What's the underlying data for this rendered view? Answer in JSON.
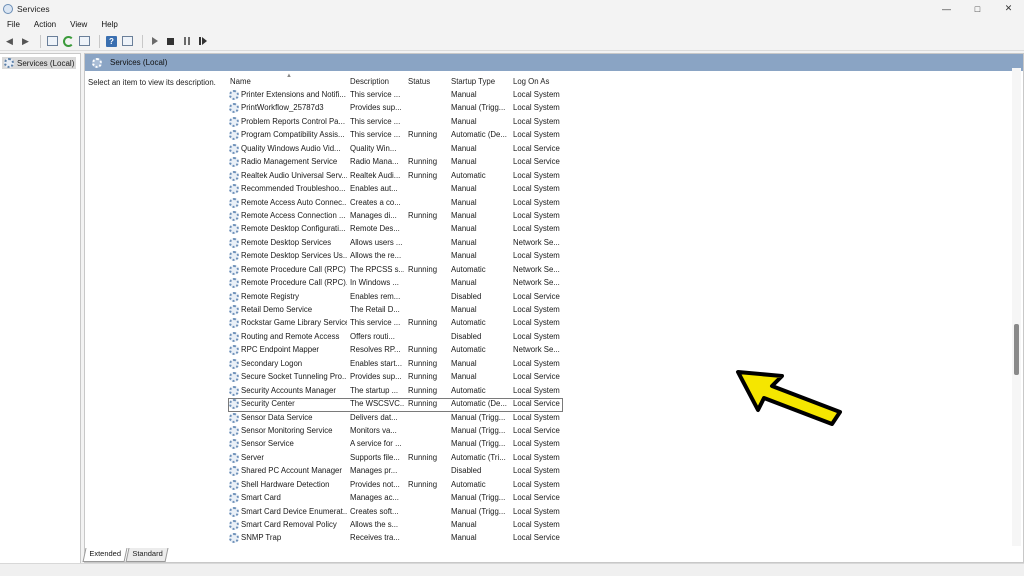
{
  "window": {
    "title": "Services",
    "controls": {
      "minimize": "—",
      "maximize": "□",
      "close": "✕"
    }
  },
  "menu": [
    "File",
    "Action",
    "View",
    "Help"
  ],
  "toolbar": {
    "icons": [
      "back-icon",
      "forward-icon",
      "show-hide-tree-icon",
      "refresh-icon",
      "export-icon",
      "help-icon",
      "properties-icon",
      "start-icon",
      "stop-icon",
      "pause-icon",
      "restart-icon"
    ]
  },
  "tree": {
    "root_label": "Services (Local)"
  },
  "pane": {
    "header_title": "Services (Local)",
    "description_prompt": "Select an item to view its description."
  },
  "table": {
    "columns": [
      "Name",
      "Description",
      "Status",
      "Startup Type",
      "Log On As"
    ],
    "rows": [
      {
        "name": "Printer Extensions and Notifi...",
        "description": "This service ...",
        "status": "",
        "startup": "Manual",
        "logon": "Local System"
      },
      {
        "name": "PrintWorkflow_25787d3",
        "description": "Provides sup...",
        "status": "",
        "startup": "Manual (Trigg...",
        "logon": "Local System"
      },
      {
        "name": "Problem Reports Control Pa...",
        "description": "This service ...",
        "status": "",
        "startup": "Manual",
        "logon": "Local System"
      },
      {
        "name": "Program Compatibility Assis...",
        "description": "This service ...",
        "status": "Running",
        "startup": "Automatic (De...",
        "logon": "Local System"
      },
      {
        "name": "Quality Windows Audio Vid...",
        "description": "Quality Win...",
        "status": "",
        "startup": "Manual",
        "logon": "Local Service"
      },
      {
        "name": "Radio Management Service",
        "description": "Radio Mana...",
        "status": "Running",
        "startup": "Manual",
        "logon": "Local Service"
      },
      {
        "name": "Realtek Audio Universal Serv...",
        "description": "Realtek Audi...",
        "status": "Running",
        "startup": "Automatic",
        "logon": "Local System"
      },
      {
        "name": "Recommended Troubleshoo...",
        "description": "Enables aut...",
        "status": "",
        "startup": "Manual",
        "logon": "Local System"
      },
      {
        "name": "Remote Access Auto Connec...",
        "description": "Creates a co...",
        "status": "",
        "startup": "Manual",
        "logon": "Local System"
      },
      {
        "name": "Remote Access Connection ...",
        "description": "Manages di...",
        "status": "Running",
        "startup": "Manual",
        "logon": "Local System"
      },
      {
        "name": "Remote Desktop Configurati...",
        "description": "Remote Des...",
        "status": "",
        "startup": "Manual",
        "logon": "Local System"
      },
      {
        "name": "Remote Desktop Services",
        "description": "Allows users ...",
        "status": "",
        "startup": "Manual",
        "logon": "Network Se..."
      },
      {
        "name": "Remote Desktop Services Us...",
        "description": "Allows the re...",
        "status": "",
        "startup": "Manual",
        "logon": "Local System"
      },
      {
        "name": "Remote Procedure Call (RPC)",
        "description": "The RPCSS s...",
        "status": "Running",
        "startup": "Automatic",
        "logon": "Network Se..."
      },
      {
        "name": "Remote Procedure Call (RPC)...",
        "description": "In Windows ...",
        "status": "",
        "startup": "Manual",
        "logon": "Network Se..."
      },
      {
        "name": "Remote Registry",
        "description": "Enables rem...",
        "status": "",
        "startup": "Disabled",
        "logon": "Local Service"
      },
      {
        "name": "Retail Demo Service",
        "description": "The Retail D...",
        "status": "",
        "startup": "Manual",
        "logon": "Local System"
      },
      {
        "name": "Rockstar Game Library Service",
        "description": "This service ...",
        "status": "Running",
        "startup": "Automatic",
        "logon": "Local System"
      },
      {
        "name": "Routing and Remote Access",
        "description": "Offers routi...",
        "status": "",
        "startup": "Disabled",
        "logon": "Local System"
      },
      {
        "name": "RPC Endpoint Mapper",
        "description": "Resolves RP...",
        "status": "Running",
        "startup": "Automatic",
        "logon": "Network Se..."
      },
      {
        "name": "Secondary Logon",
        "description": "Enables start...",
        "status": "Running",
        "startup": "Manual",
        "logon": "Local System"
      },
      {
        "name": "Secure Socket Tunneling Pro...",
        "description": "Provides sup...",
        "status": "Running",
        "startup": "Manual",
        "logon": "Local Service"
      },
      {
        "name": "Security Accounts Manager",
        "description": "The startup ...",
        "status": "Running",
        "startup": "Automatic",
        "logon": "Local System"
      },
      {
        "name": "Security Center",
        "description": "The WSCSVC...",
        "status": "Running",
        "startup": "Automatic (De...",
        "logon": "Local Service",
        "selected": true
      },
      {
        "name": "Sensor Data Service",
        "description": "Delivers dat...",
        "status": "",
        "startup": "Manual (Trigg...",
        "logon": "Local System"
      },
      {
        "name": "Sensor Monitoring Service",
        "description": "Monitors va...",
        "status": "",
        "startup": "Manual (Trigg...",
        "logon": "Local Service"
      },
      {
        "name": "Sensor Service",
        "description": "A service for ...",
        "status": "",
        "startup": "Manual (Trigg...",
        "logon": "Local System"
      },
      {
        "name": "Server",
        "description": "Supports file...",
        "status": "Running",
        "startup": "Automatic (Tri...",
        "logon": "Local System"
      },
      {
        "name": "Shared PC Account Manager",
        "description": "Manages pr...",
        "status": "",
        "startup": "Disabled",
        "logon": "Local System"
      },
      {
        "name": "Shell Hardware Detection",
        "description": "Provides not...",
        "status": "Running",
        "startup": "Automatic",
        "logon": "Local System"
      },
      {
        "name": "Smart Card",
        "description": "Manages ac...",
        "status": "",
        "startup": "Manual (Trigg...",
        "logon": "Local Service"
      },
      {
        "name": "Smart Card Device Enumerat...",
        "description": "Creates soft...",
        "status": "",
        "startup": "Manual (Trigg...",
        "logon": "Local System"
      },
      {
        "name": "Smart Card Removal Policy",
        "description": "Allows the s...",
        "status": "",
        "startup": "Manual",
        "logon": "Local System"
      },
      {
        "name": "SNMP Trap",
        "description": "Receives tra...",
        "status": "",
        "startup": "Manual",
        "logon": "Local Service"
      }
    ]
  },
  "tabs": [
    "Extended",
    "Standard"
  ],
  "scroll_position": 0.6,
  "annotation_color": "#f5e600"
}
